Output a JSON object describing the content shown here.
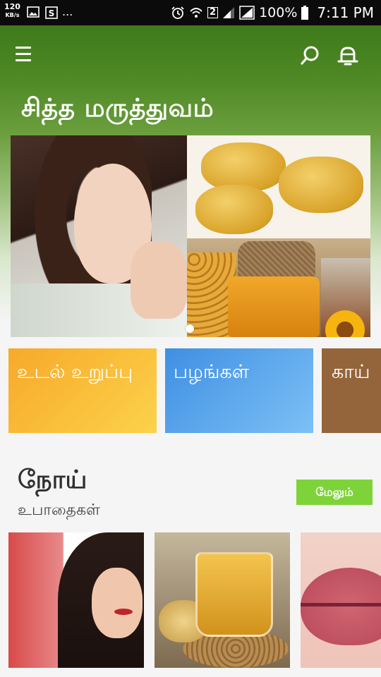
{
  "status_bar": {
    "speed_value": "120",
    "speed_unit": "KB/s",
    "more_indicator": "...",
    "sim_badge": "2",
    "battery_percent": "100%",
    "time": "7:11 PM",
    "icons": [
      "image-icon",
      "s-app-icon",
      "alarm-icon",
      "wifi-icon",
      "signal-icon",
      "signal-icon",
      "battery-icon"
    ]
  },
  "appbar": {
    "icons": [
      "menu-icon",
      "search-icon",
      "bell-icon"
    ]
  },
  "app_title": "சித்த மருத்துவம்",
  "banner": {
    "active_slide": 1
  },
  "categories": [
    {
      "label": "உடல் உறுப்பு",
      "color": "#f7a92a"
    },
    {
      "label": "பழங்கள்",
      "color": "#3f8fe3"
    },
    {
      "label": "காய்",
      "color": "#94653a"
    }
  ],
  "section": {
    "title": "நோய்",
    "subtitle": "உபாதைகள்",
    "more_label": "மேலும்",
    "more_color": "#7fd33a"
  },
  "colors": {
    "header_green": "#3f7a1a",
    "background": "#f5f5f5"
  }
}
